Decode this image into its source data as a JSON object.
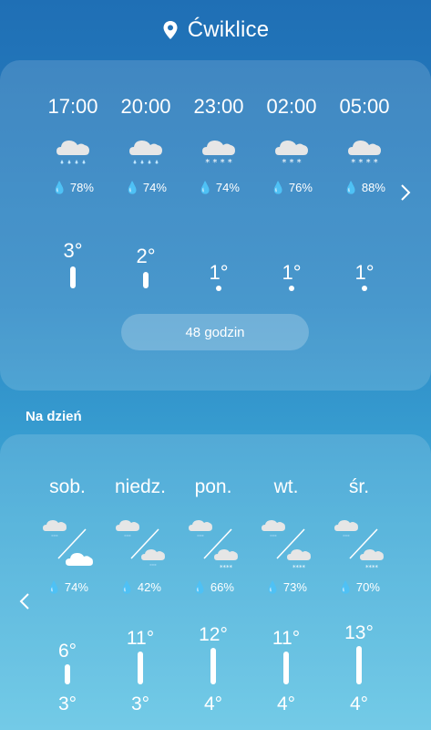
{
  "header": {
    "location": "Ćwiklice",
    "location_icon": "map-pin-icon"
  },
  "hourly": {
    "items": [
      {
        "time": "17:00",
        "icon": "rain-cloud-icon",
        "humidity": "78%",
        "temp": "3°"
      },
      {
        "time": "20:00",
        "icon": "rain-cloud-icon",
        "humidity": "74%",
        "temp": "2°"
      },
      {
        "time": "23:00",
        "icon": "snow-cloud-icon",
        "humidity": "74%",
        "temp": "1°"
      },
      {
        "time": "02:00",
        "icon": "snow-cloud-icon",
        "humidity": "76%",
        "temp": "1°"
      },
      {
        "time": "05:00",
        "icon": "snow-cloud-icon",
        "humidity": "88%",
        "temp": "1°"
      }
    ],
    "more_button": "48 godzin",
    "next_icon": "chevron-right-icon"
  },
  "daily": {
    "title": "Na dzień",
    "prev_icon": "chevron-left-icon",
    "items": [
      {
        "day": "sob.",
        "humidity": "74%",
        "max": "6°",
        "min": "3°"
      },
      {
        "day": "niedz.",
        "humidity": "42%",
        "max": "11°",
        "min": "3°"
      },
      {
        "day": "pon.",
        "humidity": "66%",
        "max": "12°",
        "min": "4°"
      },
      {
        "day": "wt.",
        "humidity": "73%",
        "max": "11°",
        "min": "4°"
      },
      {
        "day": "śr.",
        "humidity": "70%",
        "max": "13°",
        "min": "4°"
      }
    ]
  }
}
